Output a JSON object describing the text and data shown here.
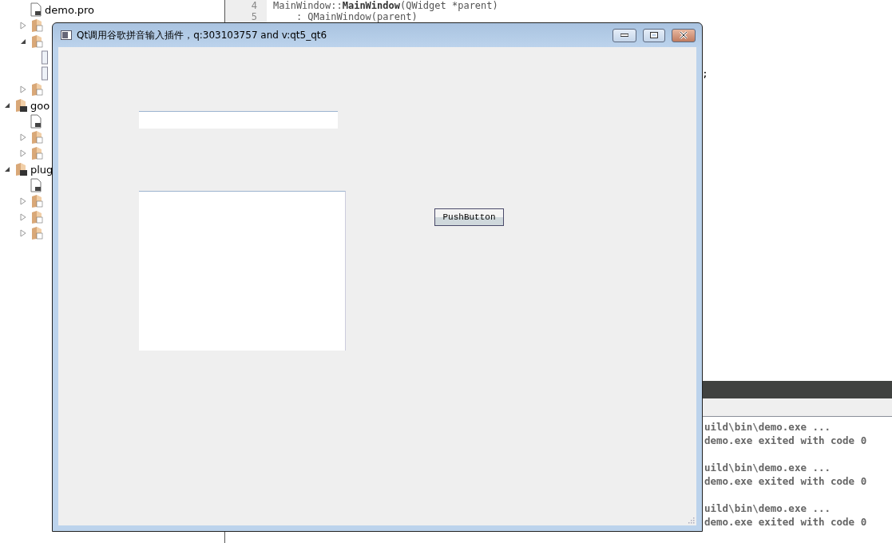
{
  "project_tree": {
    "partial_project_children": [
      {
        "label": "demo.pro",
        "kind": "pro"
      },
      {
        "kind": "headers",
        "expanded": false
      },
      {
        "kind": "sources",
        "expanded": true,
        "children": [
          {
            "kind": "cpp"
          },
          {
            "kind": "cpp"
          }
        ]
      },
      {
        "kind": "forms",
        "expanded": false
      }
    ],
    "projects": [
      {
        "label": "goo",
        "kind": "project",
        "expanded": true,
        "children": [
          {
            "kind": "pro"
          },
          {
            "kind": "headers",
            "expanded": false
          },
          {
            "kind": "sources",
            "expanded": false
          }
        ]
      },
      {
        "label": "plug",
        "kind": "project",
        "expanded": true,
        "children": [
          {
            "kind": "pro"
          },
          {
            "kind": "headers",
            "expanded": false
          },
          {
            "kind": "sources",
            "expanded": false
          },
          {
            "kind": "resources",
            "expanded": false
          }
        ]
      }
    ]
  },
  "editor": {
    "lines": [
      {
        "number": "4",
        "code": "MainWindow::**MainWindow**(QWidget *parent)"
      },
      {
        "number": "5",
        "code": "    : QMainWindow(parent)"
      }
    ],
    "visible_fragment": ";"
  },
  "output": {
    "runs": [
      {
        "start": "uild\\bin\\demo.exe ...",
        "end": "demo.exe exited with code 0"
      },
      {
        "start": "uild\\bin\\demo.exe ...",
        "end": "demo.exe exited with code 0"
      },
      {
        "start": "uild\\bin\\demo.exe ...",
        "end": "demo.exe exited with code 0"
      }
    ]
  },
  "window": {
    "title": "Qt调用谷歌拼音输入插件，q:303103757 and v:qt5_qt6",
    "button": "PushButton"
  }
}
